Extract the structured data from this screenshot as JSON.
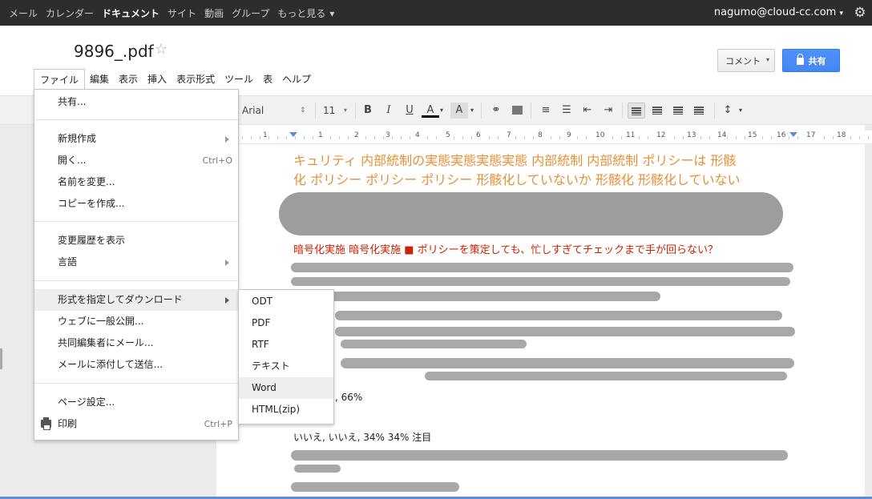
{
  "topbar": {
    "links": [
      "メール",
      "カレンダー",
      "ドキュメント",
      "サイト",
      "動画",
      "グループ",
      "もっと見る"
    ],
    "active": "ドキュメント",
    "account": "nagumo@cloud-cc.com",
    "account_arrow": "▾",
    "more_arrow": "▾",
    "settings_icon": "gear-icon"
  },
  "document": {
    "title": "9896_.pdf",
    "star_icon": "☆",
    "comment_label": "コメント",
    "comment_arrow": "▾",
    "share_label": "共有"
  },
  "menubar": [
    "ファイル",
    "編集",
    "表示",
    "挿入",
    "表示形式",
    "ツール",
    "表",
    "ヘルプ"
  ],
  "toolbar": {
    "font": "Arial",
    "font_size": "11",
    "bold": "B",
    "italic": "I",
    "underline": "U",
    "text_color": "A",
    "highlight": "A"
  },
  "ruler": [
    "1",
    "1",
    "2",
    "3",
    "4",
    "5",
    "6",
    "7",
    "8",
    "9",
    "10",
    "11",
    "12",
    "13",
    "14",
    "15",
    "16",
    "17",
    "18"
  ],
  "content": {
    "orange_line1": "キュリティ 内部統制の実態実態実態実態 内部統制 内部統制 ポリシーは 形骸",
    "orange_line2": "化 ポリシー ポリシー ポリシー 形骸化していないか 形骸化 形骸化していない",
    "red_heading": "暗号化実施 暗号化実施 ■ ポリシーを策定しても、忙しすぎてチェックまで手が回らない？",
    "stat1": ", 66%",
    "stat2": "いいえ, いいえ, 34% 34% 注目"
  },
  "file_menu": {
    "items": [
      {
        "label": "共有..."
      },
      {
        "label": "新規作成",
        "submenu": true
      },
      {
        "label": "開く...",
        "shortcut": "Ctrl+O"
      },
      {
        "label": "名前を変更..."
      },
      {
        "label": "コピーを作成..."
      },
      {
        "label": "変更履歴を表示"
      },
      {
        "label": "言語",
        "submenu": true
      },
      {
        "label": "形式を指定してダウンロード",
        "submenu": true
      },
      {
        "label": "ウェブに一般公開..."
      },
      {
        "label": "共同編集者にメール..."
      },
      {
        "label": "メールに添付して送信..."
      },
      {
        "label": "ページ設定..."
      },
      {
        "label": "印刷",
        "shortcut": "Ctrl+P"
      }
    ]
  },
  "download_submenu": [
    "ODT",
    "PDF",
    "RTF",
    "テキスト",
    "Word",
    "HTML(zip)"
  ],
  "colors": {
    "topbar_bg": "#2d2d2d",
    "share_blue": "#4d90fe",
    "orange_text": "#e69138",
    "red_text": "#cc2200",
    "menu_highlight": "#eeeeee"
  }
}
